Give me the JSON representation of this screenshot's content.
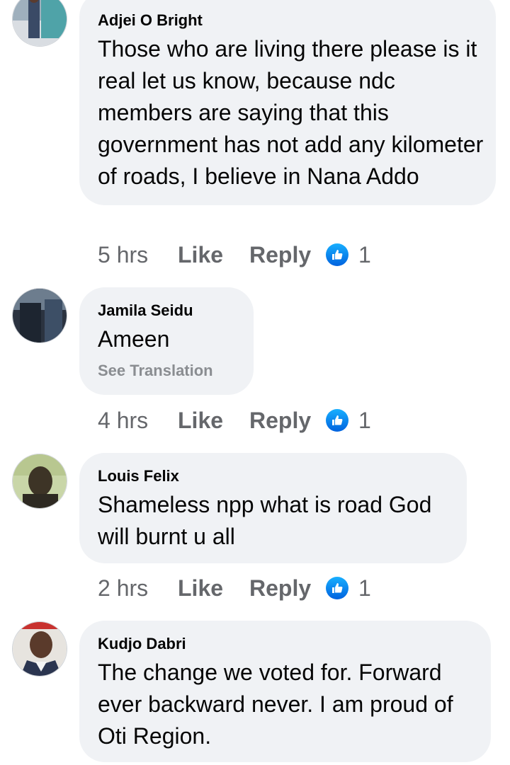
{
  "comments": [
    {
      "author": "Adjei O Bright",
      "text": "Those who are living there please is it real let us know, because ndc members are saying that this government has not add any kilometer of roads, I believe in Nana Addo",
      "time": "5 hrs",
      "like_label": "Like",
      "reply_label": "Reply",
      "reactions": "1"
    },
    {
      "author": "Jamila Seidu",
      "text": "Ameen",
      "see_translation": "See Translation",
      "time": "4 hrs",
      "like_label": "Like",
      "reply_label": "Reply",
      "reactions": "1"
    },
    {
      "author": "Louis Felix",
      "text": "Shameless npp what is road God will burnt u all",
      "time": "2 hrs",
      "like_label": "Like",
      "reply_label": "Reply",
      "reactions": "1"
    },
    {
      "author": "Kudjo Dabri",
      "text": "The change we voted for. Forward ever backward never. I am proud of Oti Region."
    }
  ],
  "colors": {
    "bubble": "#f0f2f5",
    "like_blue": "#1877f2",
    "meta_gray": "#65676b"
  },
  "icons": {
    "reaction": "thumbs-up-icon"
  }
}
